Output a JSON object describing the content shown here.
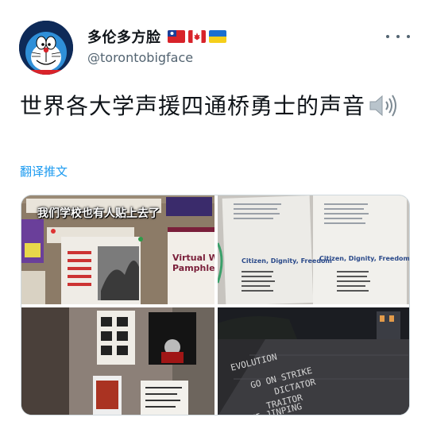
{
  "user": {
    "display_name": "多伦多方脸",
    "handle": "@torontobigface",
    "flags": [
      "taiwan-flag-icon",
      "canada-flag-icon",
      "ukraine-flag-icon"
    ]
  },
  "tweet": {
    "text": "世界各大学声援四通桥勇士的声音",
    "translate_label": "翻译推文"
  },
  "media": {
    "photo1_caption": "我们学校也有人贴上去了",
    "photo1_poster": "Virtual W\nPamphlet",
    "photo2_titles": [
      "Citizen, Dignity, Freedom",
      "Citizen, Dignity, Freedom"
    ],
    "photo4_chalk": [
      "EVOLUTION",
      "GO ON STRIKE",
      "DICTATOR",
      "TRAITOR",
      "XI JINPING"
    ]
  },
  "colors": {
    "link": "#1d9bf0",
    "secondary_text": "#536471",
    "primary_text": "#0f1419"
  }
}
